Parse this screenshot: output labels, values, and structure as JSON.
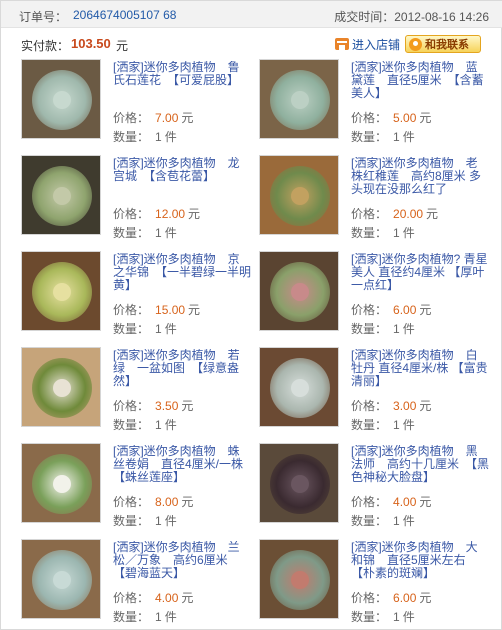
{
  "order": {
    "label": "订单号：",
    "number": "2064674005107 68",
    "deal_time": "成交时间：2012-08-16 14:26"
  },
  "payment": {
    "label": "实付款：",
    "amount": "103.50",
    "unit": "元",
    "enter_shop_label": "进入店铺",
    "contact_label": "和我联系",
    "colors": {
      "amount": "#c8491c",
      "link": "#225aa8"
    }
  },
  "items": [
    {
      "title": "[洒家]迷你多肉植物　鲁氏石莲花　【可爱屁股】",
      "price_label": "价格：",
      "price": "7.00",
      "price_unit": "元",
      "qty_label": "数量：",
      "qty": "1",
      "qty_unit": "件",
      "thumb_colors": [
        "#6b5a44",
        "#9fb8ac",
        "#c7d9cf"
      ]
    },
    {
      "title": "[洒家]迷你多肉植物　蓝黛莲　直径5厘米　【含蓄美人】",
      "price_label": "价格：",
      "price": "5.00",
      "price_unit": "元",
      "qty_label": "数量：",
      "qty": "1",
      "qty_unit": "件",
      "thumb_colors": [
        "#7b6448",
        "#8fb09e",
        "#bcd0c4"
      ]
    },
    {
      "title": "[洒家]迷你多肉植物　龙宫城　【含苞花蕾】",
      "price_label": "价格：",
      "price": "12.00",
      "price_unit": "元",
      "qty_label": "数量：",
      "qty": "1",
      "qty_unit": "件",
      "thumb_colors": [
        "#3f3b2e",
        "#8fa46e",
        "#c3c9a8"
      ]
    },
    {
      "title": "[洒家]迷你多肉植物　老株红稚莲　高约8厘米 多头现在没那么红了",
      "price_label": "价格：",
      "price": "20.00",
      "price_unit": "元",
      "qty_label": "数量：",
      "qty": "1",
      "qty_unit": "件",
      "thumb_colors": [
        "#9a6a3a",
        "#6f8a4c",
        "#c2a160"
      ]
    },
    {
      "title": "[洒家]迷你多肉植物　京之华锦　【一半碧绿一半明黄】",
      "price_label": "价格：",
      "price": "15.00",
      "price_unit": "元",
      "qty_label": "数量：",
      "qty": "1",
      "qty_unit": "件",
      "thumb_colors": [
        "#6c4a2e",
        "#a9b85a",
        "#e6e0a0"
      ]
    },
    {
      "title": "[洒家]迷你多肉植物? 青星美人 直径约4厘米 【厚叶一点红】",
      "price_label": "价格：",
      "price": "6.00",
      "price_unit": "元",
      "qty_label": "数量：",
      "qty": "1",
      "qty_unit": "件",
      "thumb_colors": [
        "#5a4431",
        "#8aa06a",
        "#c88a8a"
      ]
    },
    {
      "title": "[洒家]迷你多肉植物　若绿　一盆如图　【绿意盎然】",
      "price_label": "价格：",
      "price": "3.50",
      "price_unit": "元",
      "qty_label": "数量：",
      "qty": "1",
      "qty_unit": "件",
      "thumb_colors": [
        "#c6a47a",
        "#6f8a3a",
        "#e8e2d4"
      ]
    },
    {
      "title": "[洒家]迷你多肉植物　白牡丹 直径4厘米/株 【富贵清丽】",
      "price_label": "价格：",
      "price": "3.00",
      "price_unit": "元",
      "qty_label": "数量：",
      "qty": "1",
      "qty_unit": "件",
      "thumb_colors": [
        "#6b4a33",
        "#aab6ae",
        "#d7dedb"
      ]
    },
    {
      "title": "[洒家]迷你多肉植物　蛛丝卷娟　直径4厘米/一株　【蛛丝莲座】",
      "price_label": "价格：",
      "price": "8.00",
      "price_unit": "元",
      "qty_label": "数量：",
      "qty": "1",
      "qty_unit": "件",
      "thumb_colors": [
        "#8a6a4a",
        "#7aa05a",
        "#f2f2ea"
      ]
    },
    {
      "title": "[洒家]迷你多肉植物　黑法师　高约十几厘米　【黑色神秘大脸盘】",
      "price_label": "价格：",
      "price": "4.00",
      "price_unit": "元",
      "qty_label": "数量：",
      "qty": "1",
      "qty_unit": "件",
      "thumb_colors": [
        "#5a4a3a",
        "#3a2a30",
        "#6a5660"
      ]
    },
    {
      "title": "[洒家]迷你多肉植物　兰松／万象　高约6厘米　【碧海蓝天】",
      "price_label": "价格：",
      "price": "4.00",
      "price_unit": "元",
      "qty_label": "数量：",
      "qty": "1",
      "qty_unit": "件",
      "thumb_colors": [
        "#8a6a4a",
        "#9bb6b0",
        "#c8dad6"
      ]
    },
    {
      "title": "[洒家]迷你多肉植物　大和锦　直径5厘米左右　【朴素的斑斓】",
      "price_label": "价格：",
      "price": "6.00",
      "price_unit": "元",
      "qty_label": "数量：",
      "qty": "1",
      "qty_unit": "件",
      "thumb_colors": [
        "#6b4f35",
        "#7f9a88",
        "#c27b6e"
      ]
    }
  ]
}
